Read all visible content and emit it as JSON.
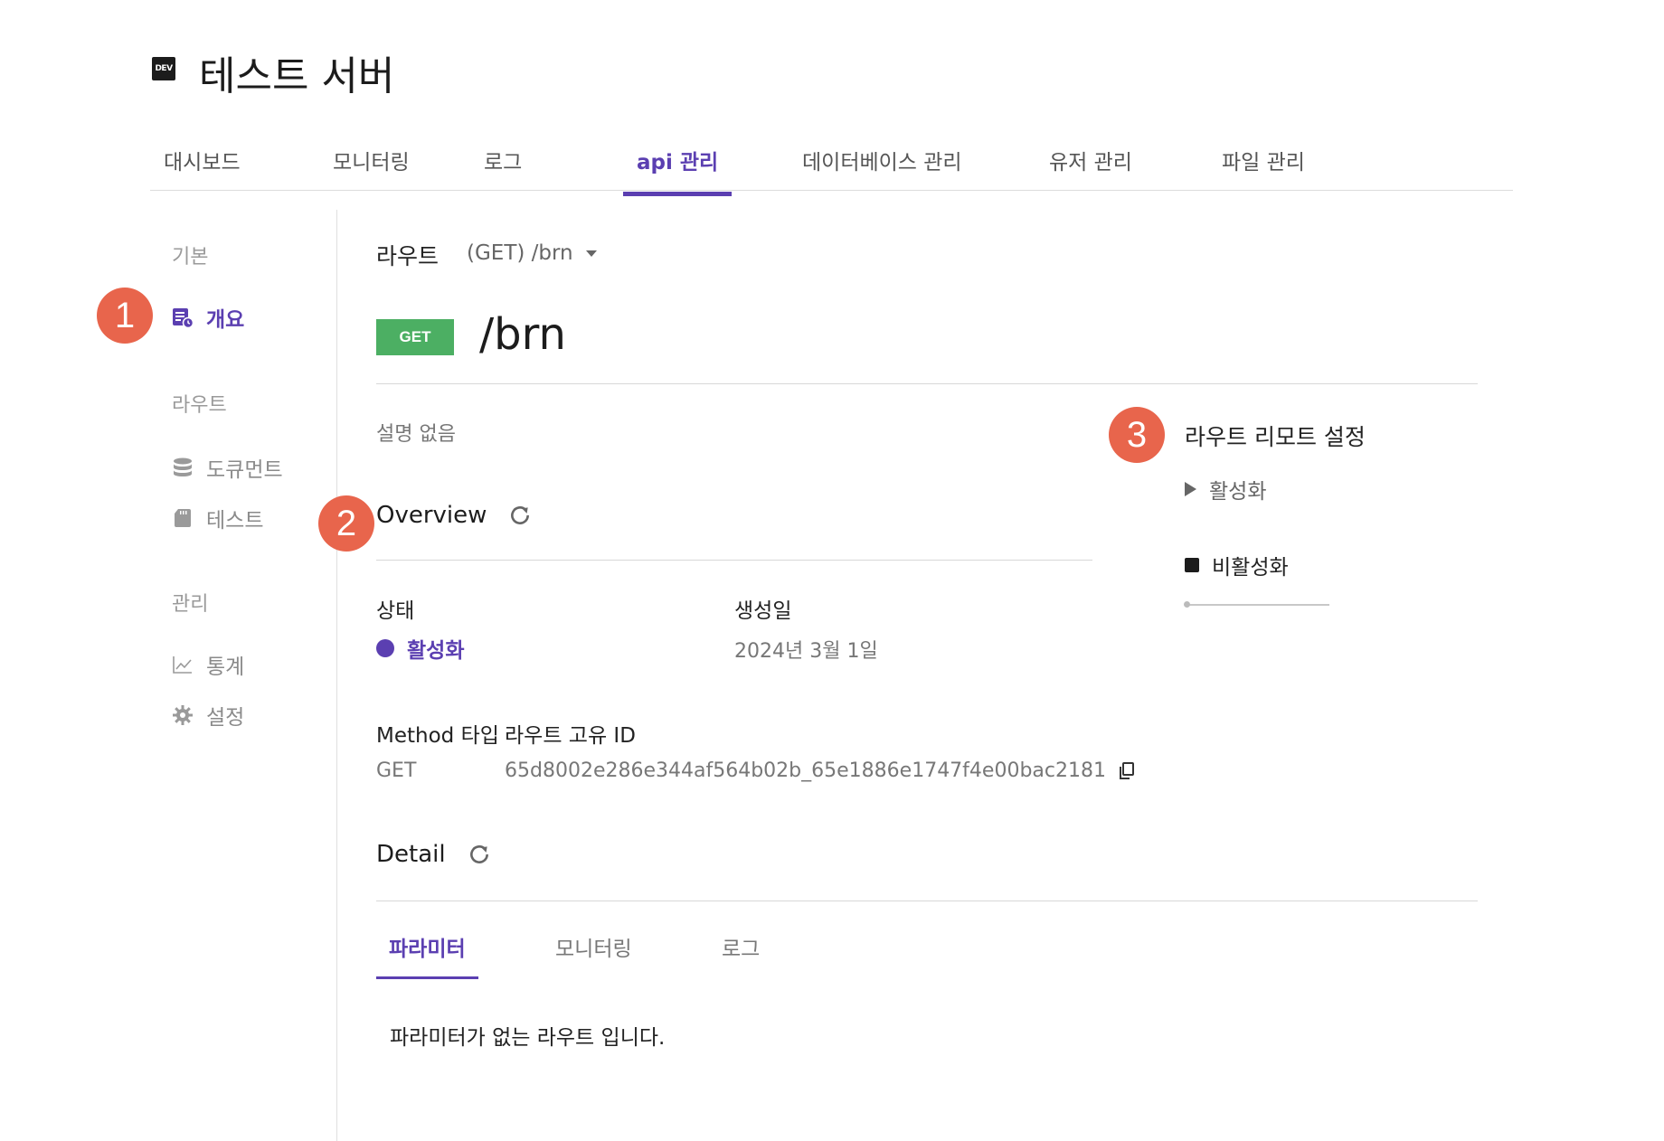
{
  "header": {
    "env_badge": "DEV",
    "title": "테스트 서버"
  },
  "nav": {
    "items": [
      {
        "label": "대시보드"
      },
      {
        "label": "모니터링"
      },
      {
        "label": "로그"
      },
      {
        "label": "api 관리"
      },
      {
        "label": "데이터베이스 관리"
      },
      {
        "label": "유저 관리"
      },
      {
        "label": "파일 관리"
      }
    ],
    "active_index": 3
  },
  "sidebar": {
    "groups": [
      {
        "title": "기본",
        "items": [
          {
            "label": "개요",
            "icon": "overview-icon",
            "active": true
          }
        ]
      },
      {
        "title": "라우트",
        "items": [
          {
            "label": "도큐먼트",
            "icon": "database-icon"
          },
          {
            "label": "테스트",
            "icon": "sd-card-icon"
          }
        ]
      },
      {
        "title": "관리",
        "items": [
          {
            "label": "통계",
            "icon": "chart-icon"
          },
          {
            "label": "설정",
            "icon": "gear-icon"
          }
        ]
      }
    ]
  },
  "annotations": [
    "1",
    "2",
    "3"
  ],
  "route": {
    "label": "라우트",
    "selected": "(GET) /brn",
    "method_badge": "GET",
    "path": "/brn",
    "description": "설명 없음"
  },
  "overview": {
    "title": "Overview",
    "status_label": "상태",
    "status_value": "활성화",
    "created_label": "생성일",
    "created_value": "2024년 3월 1일",
    "method_label": "Method 타입",
    "method_value": "GET",
    "route_id_label": "라우트 고유 ID",
    "route_id_value": "65d8002e286e344af564b02b_65e1886e1747f4e00bac2181"
  },
  "remote": {
    "title": "라우트 리모트 설정",
    "activate_label": "활성화",
    "deactivate_label": "비활성화"
  },
  "detail": {
    "title": "Detail",
    "tabs": [
      {
        "label": "파라미터"
      },
      {
        "label": "모니터링"
      },
      {
        "label": "로그"
      }
    ],
    "active_tab": 0,
    "empty_message": "파라미터가 없는 라우트 입니다."
  },
  "colors": {
    "accent": "#5b3fb1",
    "get_badge": "#4caf63",
    "annotation": "#e8654c"
  }
}
